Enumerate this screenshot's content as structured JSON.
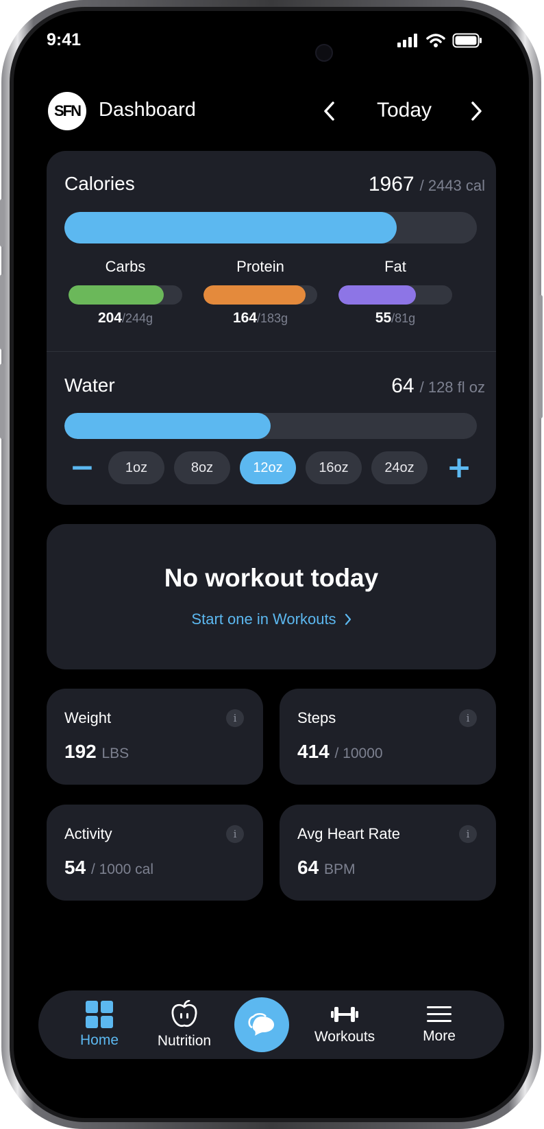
{
  "status": {
    "time": "9:41"
  },
  "header": {
    "logo_text": "SFN",
    "title": "Dashboard",
    "date_label": "Today"
  },
  "calories": {
    "title": "Calories",
    "consumed": "1967",
    "goal": "/ 2443 cal",
    "progress": 0.805
  },
  "macros": [
    {
      "name": "Carbs",
      "value": "204",
      "goal": "/244g",
      "progress": 0.836,
      "color": "#6bb85a"
    },
    {
      "name": "Protein",
      "value": "164",
      "goal": "/183g",
      "progress": 0.896,
      "color": "#e48a3c"
    },
    {
      "name": "Fat",
      "value": "55",
      "goal": "/81g",
      "progress": 0.679,
      "color": "#8d75e6"
    }
  ],
  "water": {
    "title": "Water",
    "consumed": "64",
    "goal": "/ 128 fl oz",
    "progress": 0.5,
    "minus_label": "−",
    "plus_label": "+",
    "options": [
      "1oz",
      "8oz",
      "12oz",
      "16oz",
      "24oz"
    ],
    "selected": "12oz"
  },
  "workout": {
    "title": "No workout today",
    "link": "Start one in Workouts"
  },
  "stats": [
    {
      "title": "Weight",
      "value": "192",
      "unit": "LBS"
    },
    {
      "title": "Steps",
      "value": "414",
      "unit": "/ 10000"
    },
    {
      "title": "Activity",
      "value": "54",
      "unit": "/ 1000 cal"
    },
    {
      "title": "Avg Heart Rate",
      "value": "64",
      "unit": "BPM"
    }
  ],
  "info_glyph": "i",
  "tabbar": {
    "home": "Home",
    "nutrition": "Nutrition",
    "workouts": "Workouts",
    "more": "More"
  },
  "colors": {
    "accent": "#5cb8f0",
    "card": "#1e2028",
    "track": "#33363f"
  }
}
